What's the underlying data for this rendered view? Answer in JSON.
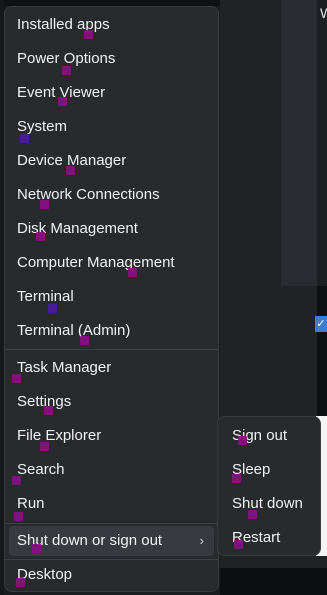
{
  "menu": {
    "items": [
      {
        "label": "Installed apps"
      },
      {
        "label": "Power Options"
      },
      {
        "label": "Event Viewer"
      },
      {
        "label": "System"
      },
      {
        "label": "Device Manager"
      },
      {
        "label": "Network Connections"
      },
      {
        "label": "Disk Management"
      },
      {
        "label": "Computer Management"
      },
      {
        "label": "Terminal"
      },
      {
        "label": "Terminal (Admin)"
      },
      {
        "label": "Task Manager"
      },
      {
        "label": "Settings"
      },
      {
        "label": "File Explorer"
      },
      {
        "label": "Search"
      },
      {
        "label": "Run"
      },
      {
        "label": "Shut down or sign out"
      },
      {
        "label": "Desktop"
      }
    ],
    "chevron": "›"
  },
  "submenu": {
    "items": [
      {
        "label": "Sign out"
      },
      {
        "label": "Sleep"
      },
      {
        "label": "Shut down"
      },
      {
        "label": "Restart"
      }
    ]
  },
  "background": {
    "corner_text": "W",
    "check_glyph": "✓"
  },
  "colors": {
    "menu_bg": "#292a2e",
    "hover_bg": "#393a3f",
    "text": "#f2f2f2",
    "marker": "#8a0f86"
  }
}
